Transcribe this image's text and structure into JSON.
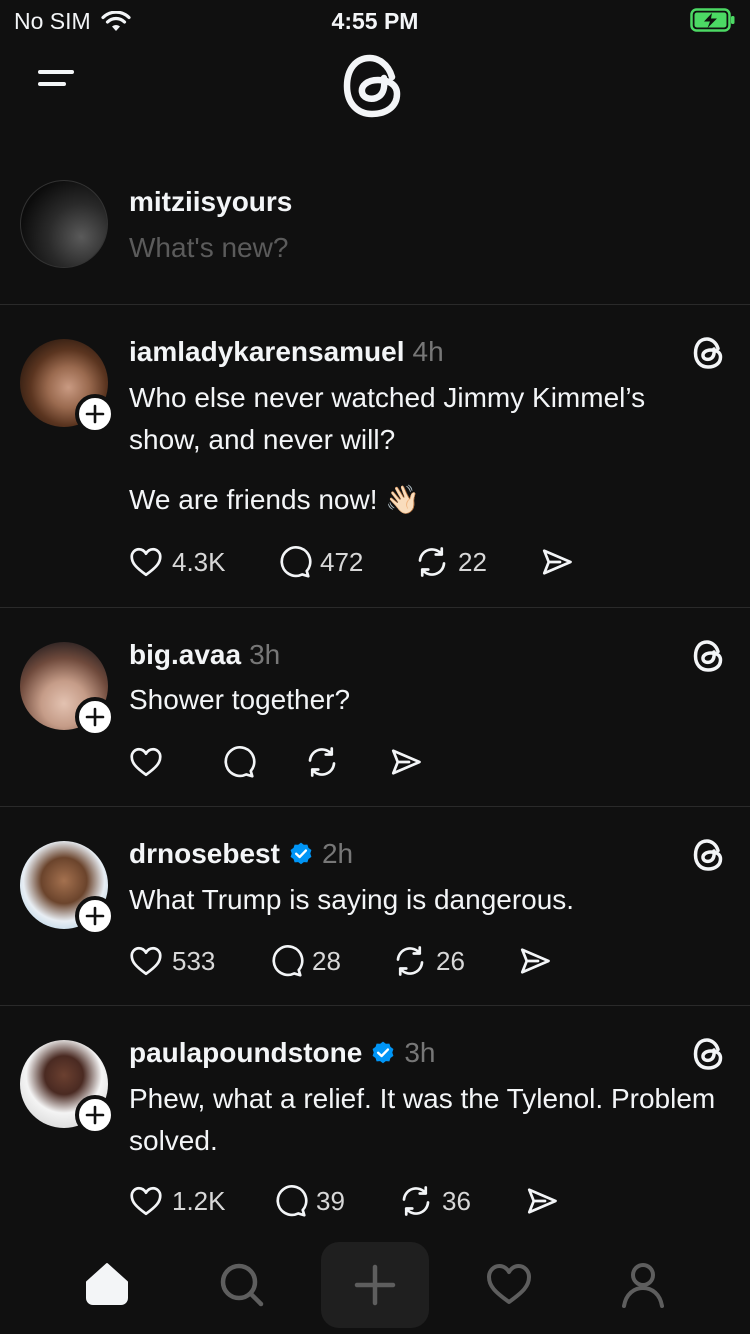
{
  "status_bar": {
    "carrier": "No SIM",
    "time": "4:55 PM"
  },
  "compose": {
    "username": "mitziisyours",
    "placeholder": "What's new?"
  },
  "posts": [
    {
      "username": "iamladykarensamuel",
      "time": "4h",
      "verified": false,
      "text": "Who else never watched Jimmy Kimmel’s show, and never will?",
      "text2": "We are friends now! 👋🏻",
      "likes": "4.3K",
      "replies": "472",
      "reposts": "22"
    },
    {
      "username": "big.avaa",
      "time": "3h",
      "verified": false,
      "text": "Shower together?",
      "likes": "",
      "replies": "",
      "reposts": ""
    },
    {
      "username": "drnosebest",
      "time": "2h",
      "verified": true,
      "text": "What Trump is saying is dangerous.",
      "likes": "533",
      "replies": "28",
      "reposts": "26"
    },
    {
      "username": "paulapoundstone",
      "time": "3h",
      "verified": true,
      "text": "Phew, what a relief. It was the Tylenol. Problem solved.",
      "likes": "1.2K",
      "replies": "39",
      "reposts": "36"
    }
  ],
  "colors": {
    "background": "#101010",
    "text": "#f3f5f7",
    "muted": "#777777",
    "verified": "#0095f6",
    "battery": "#4cd964"
  },
  "icons": [
    "menu-icon",
    "threads-logo-icon",
    "heart-icon",
    "comment-icon",
    "repost-icon",
    "share-icon",
    "home-icon",
    "search-icon",
    "plus-icon",
    "activity-icon",
    "profile-icon"
  ]
}
